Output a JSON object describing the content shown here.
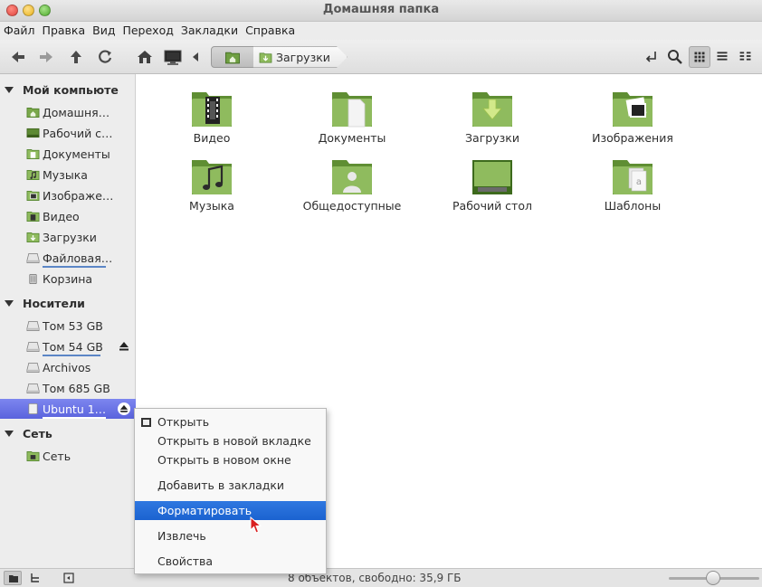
{
  "window": {
    "title": "Домашняя папка"
  },
  "menubar": {
    "items": [
      "Файл",
      "Правка",
      "Вид",
      "Переход",
      "Закладки",
      "Справка"
    ]
  },
  "toolbar": {
    "icons": [
      "back-arrow-icon",
      "forward-arrow-icon",
      "up-arrow-icon",
      "reload-icon",
      "home-icon",
      "computer-icon",
      "toggle-pathbar-icon"
    ],
    "breadcrumb": {
      "current": "Загрузки"
    },
    "right_icons": [
      "location-icon",
      "search-icon",
      "icon-view-icon",
      "list-view-icon",
      "compact-view-icon"
    ]
  },
  "sidebar": {
    "sections": [
      {
        "title": "Мой компьюте",
        "items": [
          {
            "label": "Домашня…",
            "icon": "home-folder-icon"
          },
          {
            "label": "Рабочий с…",
            "icon": "desktop-icon"
          },
          {
            "label": "Документы",
            "icon": "documents-folder-icon"
          },
          {
            "label": "Музыка",
            "icon": "music-folder-icon"
          },
          {
            "label": "Изображе…",
            "icon": "pictures-folder-icon"
          },
          {
            "label": "Видео",
            "icon": "videos-folder-icon"
          },
          {
            "label": "Загрузки",
            "icon": "downloads-folder-icon"
          },
          {
            "label": "Файловая…",
            "icon": "drive-icon"
          },
          {
            "label": "Корзина",
            "icon": "trash-icon"
          }
        ]
      },
      {
        "title": "Носители",
        "items": [
          {
            "label": "Том 53 GB",
            "icon": "drive-icon"
          },
          {
            "label": "Том 54 GB",
            "icon": "drive-icon"
          },
          {
            "label": "Archivos",
            "icon": "drive-icon"
          },
          {
            "label": "Том 685 GB",
            "icon": "drive-icon"
          },
          {
            "label": "Ubuntu 1…",
            "icon": "usb-drive-icon"
          }
        ]
      },
      {
        "title": "Сеть",
        "items": [
          {
            "label": "Сеть",
            "icon": "network-icon"
          }
        ]
      }
    ]
  },
  "content": {
    "folders": [
      {
        "label": "Видео",
        "emblem": "film-icon"
      },
      {
        "label": "Документы",
        "emblem": "document-icon"
      },
      {
        "label": "Загрузки",
        "emblem": "download-arrow-icon"
      },
      {
        "label": "Изображения",
        "emblem": "photo-icon"
      },
      {
        "label": "Музыка",
        "emblem": "music-note-icon"
      },
      {
        "label": "Общедоступные",
        "emblem": "person-icon"
      },
      {
        "label": "Рабочий стол",
        "emblem": "desktop-icon"
      },
      {
        "label": "Шаблоны",
        "emblem": "template-icon"
      }
    ]
  },
  "context_menu": {
    "items": [
      "Открыть",
      "Открыть в новой вкладке",
      "Открыть в новом окне",
      "Добавить в закладки",
      "Форматировать",
      "Извлечь",
      "Свойства"
    ],
    "highlighted": "Форматировать"
  },
  "statusbar": {
    "text": "8 объектов, свободно: 35,9 ГБ",
    "zoom_fraction": 0.5
  },
  "colors": {
    "folder_green": "#8fbb5e",
    "folder_dark": "#5f8e33",
    "selection": "#5a63dd",
    "highlight": "#1b63d0"
  }
}
